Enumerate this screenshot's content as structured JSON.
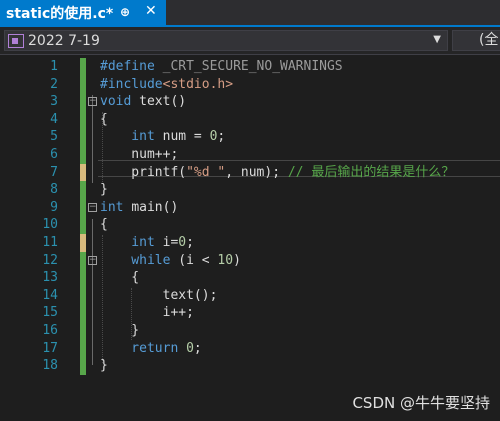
{
  "tab": {
    "title": "static的使用.c*",
    "pin": "⊕",
    "close": "✕"
  },
  "nav": {
    "project": "2022 7-19",
    "scope": "(全"
  },
  "lines": [
    {
      "n": "1",
      "tokens": [
        {
          "t": "#define ",
          "c": "kw"
        },
        {
          "t": "_CRT_SECURE_NO_WARNINGS",
          "c": "pp"
        }
      ]
    },
    {
      "n": "2",
      "tokens": [
        {
          "t": "#include",
          "c": "kw"
        },
        {
          "t": "<stdio.h>",
          "c": "str"
        }
      ]
    },
    {
      "n": "3",
      "tokens": [
        {
          "t": "void ",
          "c": "kw"
        },
        {
          "t": "text",
          "c": "fn"
        },
        {
          "t": "()",
          "c": "id"
        }
      ]
    },
    {
      "n": "4",
      "tokens": [
        {
          "t": "{",
          "c": "id"
        }
      ]
    },
    {
      "n": "5",
      "tokens": [
        {
          "t": "    int ",
          "c": "kw"
        },
        {
          "t": "num",
          "c": "id"
        },
        {
          "t": " = ",
          "c": "id"
        },
        {
          "t": "0",
          "c": "num"
        },
        {
          "t": ";",
          "c": "id"
        }
      ]
    },
    {
      "n": "6",
      "tokens": [
        {
          "t": "    num++;",
          "c": "id"
        }
      ]
    },
    {
      "n": "7",
      "tokens": [
        {
          "t": "    printf(",
          "c": "id"
        },
        {
          "t": "\"%d \"",
          "c": "str"
        },
        {
          "t": ", num); ",
          "c": "id"
        },
        {
          "t": "// 最后输出的结果是什么？",
          "c": "cmt"
        }
      ]
    },
    {
      "n": "8",
      "tokens": [
        {
          "t": "}",
          "c": "id"
        }
      ]
    },
    {
      "n": "9",
      "tokens": [
        {
          "t": "int ",
          "c": "kw"
        },
        {
          "t": "main",
          "c": "fn"
        },
        {
          "t": "()",
          "c": "id"
        }
      ]
    },
    {
      "n": "10",
      "tokens": [
        {
          "t": "{",
          "c": "id"
        }
      ]
    },
    {
      "n": "11",
      "tokens": [
        {
          "t": "    int ",
          "c": "kw"
        },
        {
          "t": "i=",
          "c": "id"
        },
        {
          "t": "0",
          "c": "num"
        },
        {
          "t": ";",
          "c": "id"
        }
      ]
    },
    {
      "n": "12",
      "tokens": [
        {
          "t": "    while ",
          "c": "kw"
        },
        {
          "t": "(i < ",
          "c": "id"
        },
        {
          "t": "10",
          "c": "num"
        },
        {
          "t": ")",
          "c": "id"
        }
      ]
    },
    {
      "n": "13",
      "tokens": [
        {
          "t": "    {",
          "c": "id"
        }
      ]
    },
    {
      "n": "14",
      "tokens": [
        {
          "t": "        text();",
          "c": "id"
        }
      ]
    },
    {
      "n": "15",
      "tokens": [
        {
          "t": "        i++;",
          "c": "id"
        }
      ]
    },
    {
      "n": "16",
      "tokens": [
        {
          "t": "    }",
          "c": "id"
        }
      ]
    },
    {
      "n": "17",
      "tokens": [
        {
          "t": "    return ",
          "c": "kw"
        },
        {
          "t": "0",
          "c": "num"
        },
        {
          "t": ";",
          "c": "id"
        }
      ]
    },
    {
      "n": "18",
      "tokens": [
        {
          "t": "}",
          "c": "id"
        }
      ]
    }
  ],
  "watermark": "CSDN @牛牛要坚持",
  "colors": {
    "accent": "#007acc",
    "change_saved": "#57a64a",
    "change_unsaved": "#d7ba7d"
  }
}
